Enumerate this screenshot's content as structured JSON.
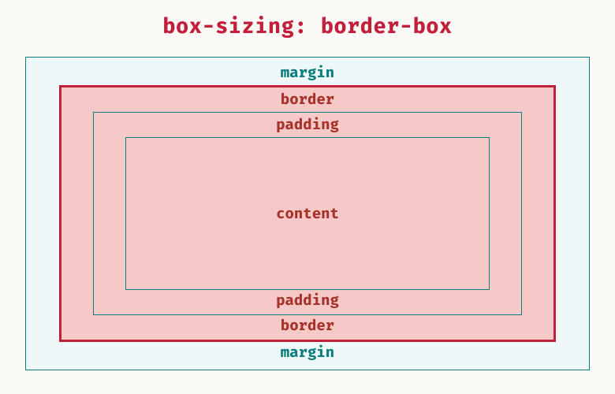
{
  "title": "box-sizing: border-box",
  "labels": {
    "margin_top": "margin",
    "margin_bottom": "margin",
    "border_top": "border",
    "border_bottom": "border",
    "padding_top": "padding",
    "padding_bottom": "padding",
    "content": "content"
  },
  "colors": {
    "accent_red": "#c2203a",
    "accent_teal": "#0b7d7d",
    "margin_bg": "#eef8f8",
    "border_bg": "#f6c9c9",
    "page_bg": "#fbfaf7"
  }
}
